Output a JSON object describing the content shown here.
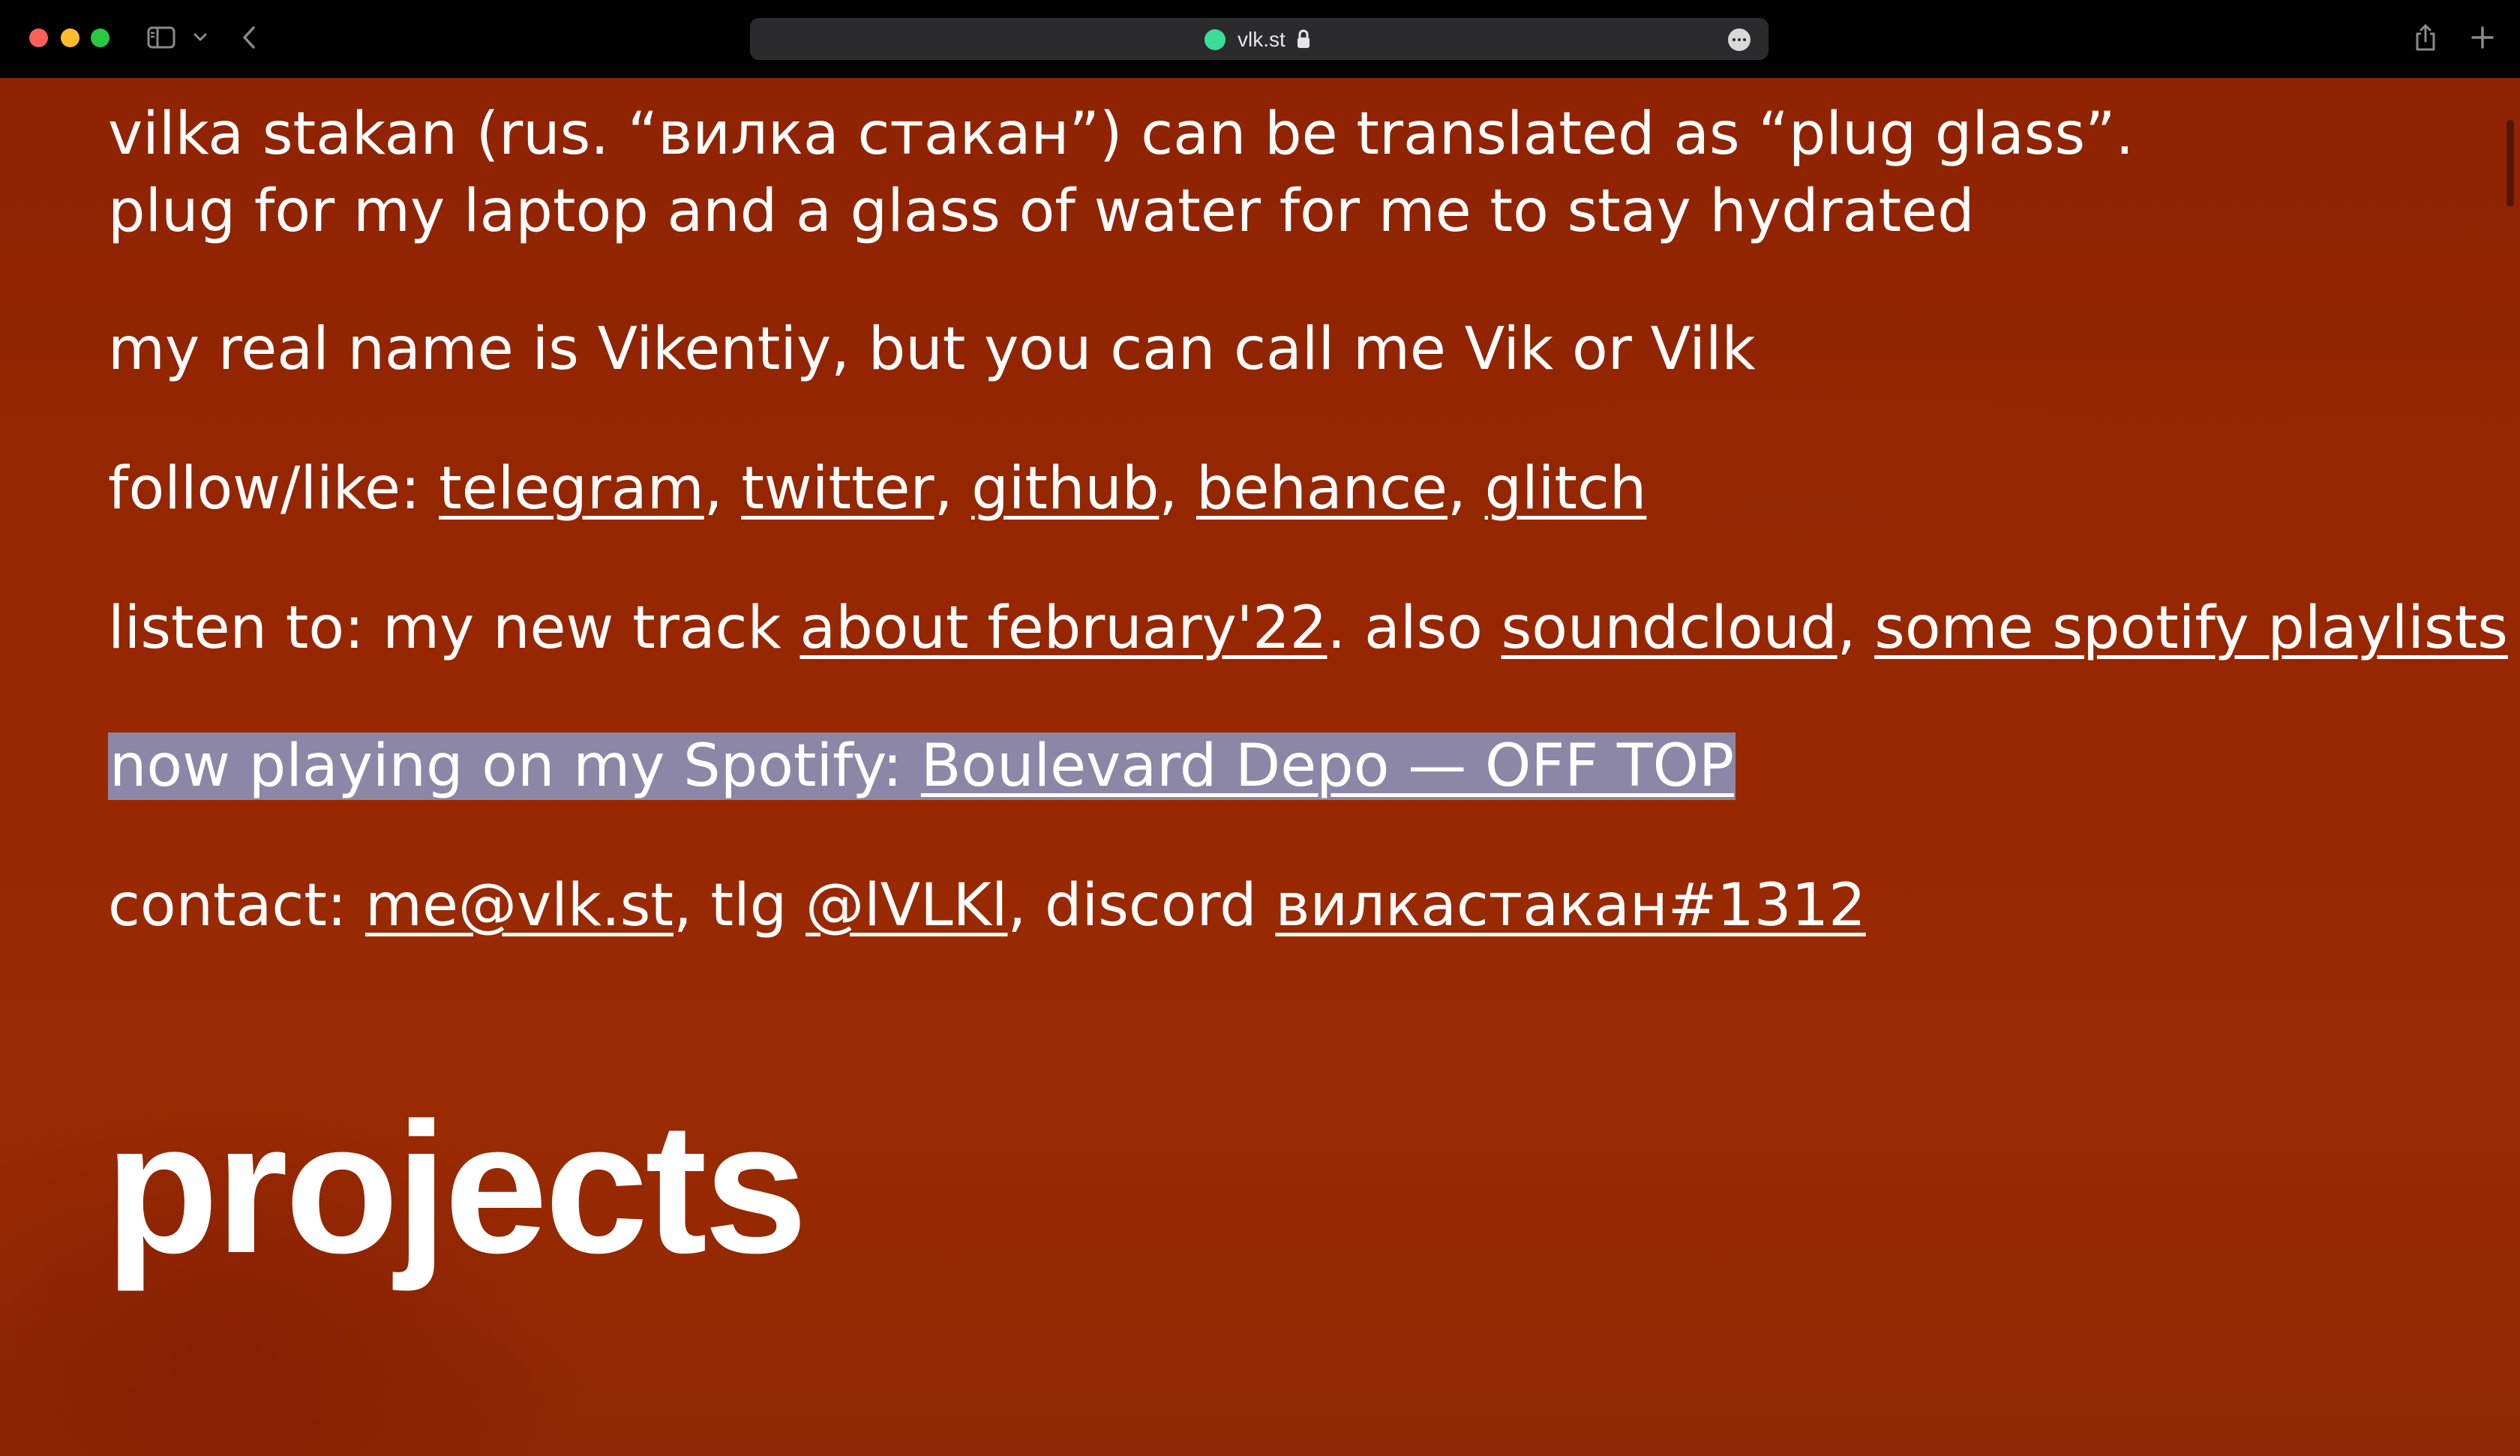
{
  "browser": {
    "url": "vlk.st",
    "icons": [
      "red-close",
      "yellow-minimize",
      "green-zoom",
      "sidebar-icon",
      "chevron-down-icon",
      "back-icon",
      "lock-icon",
      "more-icon",
      "share-icon",
      "plus-icon"
    ]
  },
  "colors": {
    "background": "#962700",
    "text": "#ffffff",
    "selection": "#8c87a6"
  },
  "content": {
    "intro_line1": "vilka stakan (rus. “вилка стакан”) can be translated as “plug glass”.",
    "intro_line2": "plug for my laptop and a glass of water for me to stay hydrated",
    "name_line": "my real name is Vikentiy, but you can call me Vik or Vilk",
    "follow": {
      "prefix": "follow/like: ",
      "links": [
        "telegram",
        "twitter",
        "github",
        "behance",
        "glitch"
      ],
      "separator": ", "
    },
    "listen": {
      "prefix": "listen to: my new track ",
      "track_link": "about february'22",
      "middle": ". also ",
      "soundcloud_link": "soundcloud",
      "separator": ", ",
      "playlists_link": "some spotify playlists"
    },
    "now_playing": {
      "prefix": "now playing on my Spotify: ",
      "track_link": "Boulevard Depo — OFF TOP"
    },
    "contact": {
      "prefix": "contact: ",
      "email_link": "me@vlk.st",
      "tlg_text": ", tlg ",
      "tlg_link": "@lVLKl",
      "discord_text": ", discord ",
      "discord_link": "вилкастакан#1312"
    },
    "projects_heading": "projects"
  }
}
